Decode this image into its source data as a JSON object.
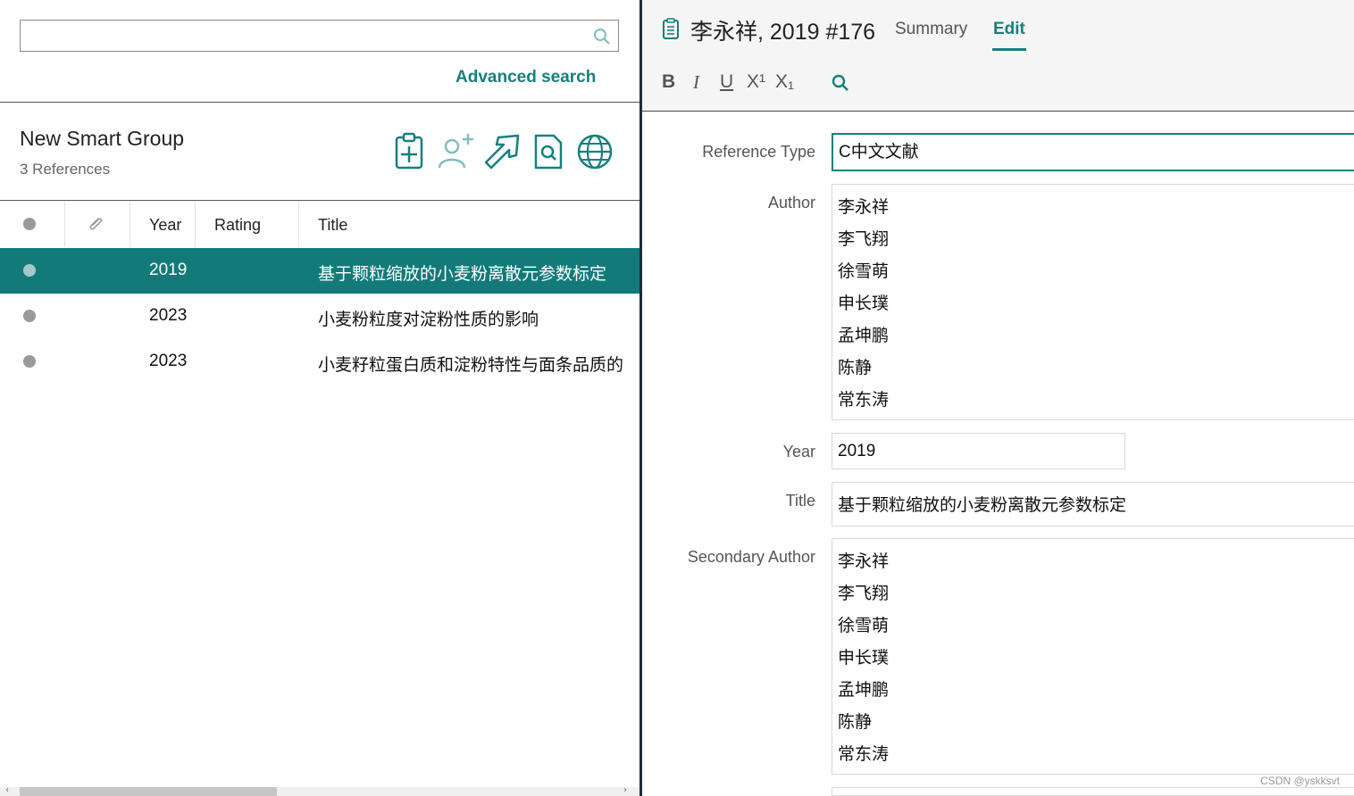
{
  "search": {
    "placeholder": "",
    "advanced_label": "Advanced search"
  },
  "group": {
    "title": "New Smart Group",
    "count": "3 References"
  },
  "group_icons": [
    "clipboard-add-icon",
    "add-user-icon",
    "share-arrow-icon",
    "find-pdf-icon",
    "globe-icon"
  ],
  "table": {
    "headers": {
      "year": "Year",
      "rating": "Rating",
      "title": "Title"
    },
    "rows": [
      {
        "year": "2019",
        "title": "基于颗粒缩放的小麦粉离散元参数标定",
        "selected": true
      },
      {
        "year": "2023",
        "title": "小麦粉粒度对淀粉性质的影响",
        "selected": false
      },
      {
        "year": "2023",
        "title": "小麦籽粒蛋白质和淀粉特性与面条品质的",
        "selected": false
      }
    ]
  },
  "reference": {
    "title": "李永祥, 2019 #176",
    "tabs": {
      "summary": "Summary",
      "edit": "Edit"
    }
  },
  "format_toolbar": {
    "bold": "B",
    "italic": "I",
    "underline": "U",
    "superscript": "X¹",
    "subscript": "X₁"
  },
  "fields": {
    "reference_type": {
      "label": "Reference Type",
      "value": "C中文文献"
    },
    "author": {
      "label": "Author",
      "values": [
        "李永祥",
        "李飞翔",
        "徐雪萌",
        "申长璞",
        "孟坤鹏",
        "陈静",
        "常东涛"
      ]
    },
    "year": {
      "label": "Year",
      "value": "2019"
    },
    "title": {
      "label": "Title",
      "value": "基于颗粒缩放的小麦粉离散元参数标定"
    },
    "secondary_author": {
      "label": "Secondary Author",
      "values": [
        "李永祥",
        "李飞翔",
        "徐雪萌",
        "申长璞",
        "孟坤鹏",
        "陈静",
        "常东涛"
      ]
    }
  },
  "watermark": "CSDN @yskksvt",
  "colors": {
    "accent": "#17807e",
    "selected_row": "#137a7a",
    "splitter": "#1d2c3a"
  }
}
